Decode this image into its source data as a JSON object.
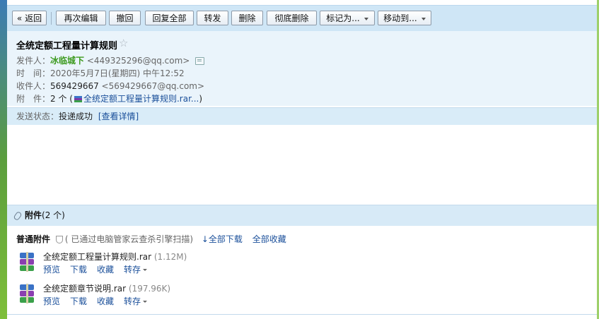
{
  "toolbar": {
    "back": "« 返回",
    "reedit": "再次编辑",
    "recall": "撤回",
    "reply_all": "回复全部",
    "forward": "转发",
    "delete": "删除",
    "delete_permanent": "彻底删除",
    "mark_as": "标记为...",
    "move_to": "移动到..."
  },
  "mail": {
    "subject": "全统定额工程量计算规则",
    "star": "☆",
    "from_label": "发件人：",
    "from_name": "冰临城下",
    "from_addr": " <449325296@qq.com>",
    "time_label": "时　间：",
    "time_value": "2020年5月7日(星期四) 中午12:52",
    "to_label": "收件人：",
    "to_name": "569429667",
    "to_addr": " <569429667@qq.com>",
    "att_label": "附　件：",
    "att_count": "2 个 (",
    "att_first": "全统定额工程量计算规则.rar...",
    "att_close": ")"
  },
  "status": {
    "label": "发送状态：",
    "value": "投递成功",
    "details": "[查看详情]"
  },
  "attachments": {
    "header_label": "附件",
    "header_count": "(2 个)",
    "section_label": "普通附件",
    "scan_text": "( 已通过电脑管家云查杀引擎扫描)",
    "download_all": "全部下载",
    "collect_all": "全部收藏",
    "files": [
      {
        "name": "全统定额工程量计算规则.rar",
        "size": "(1.12M)"
      },
      {
        "name": "全统定额章节说明.rar",
        "size": "(197.96K)"
      }
    ],
    "actions": {
      "preview": "预览",
      "download": "下载",
      "collect": "收藏",
      "save_to": "转存"
    }
  }
}
